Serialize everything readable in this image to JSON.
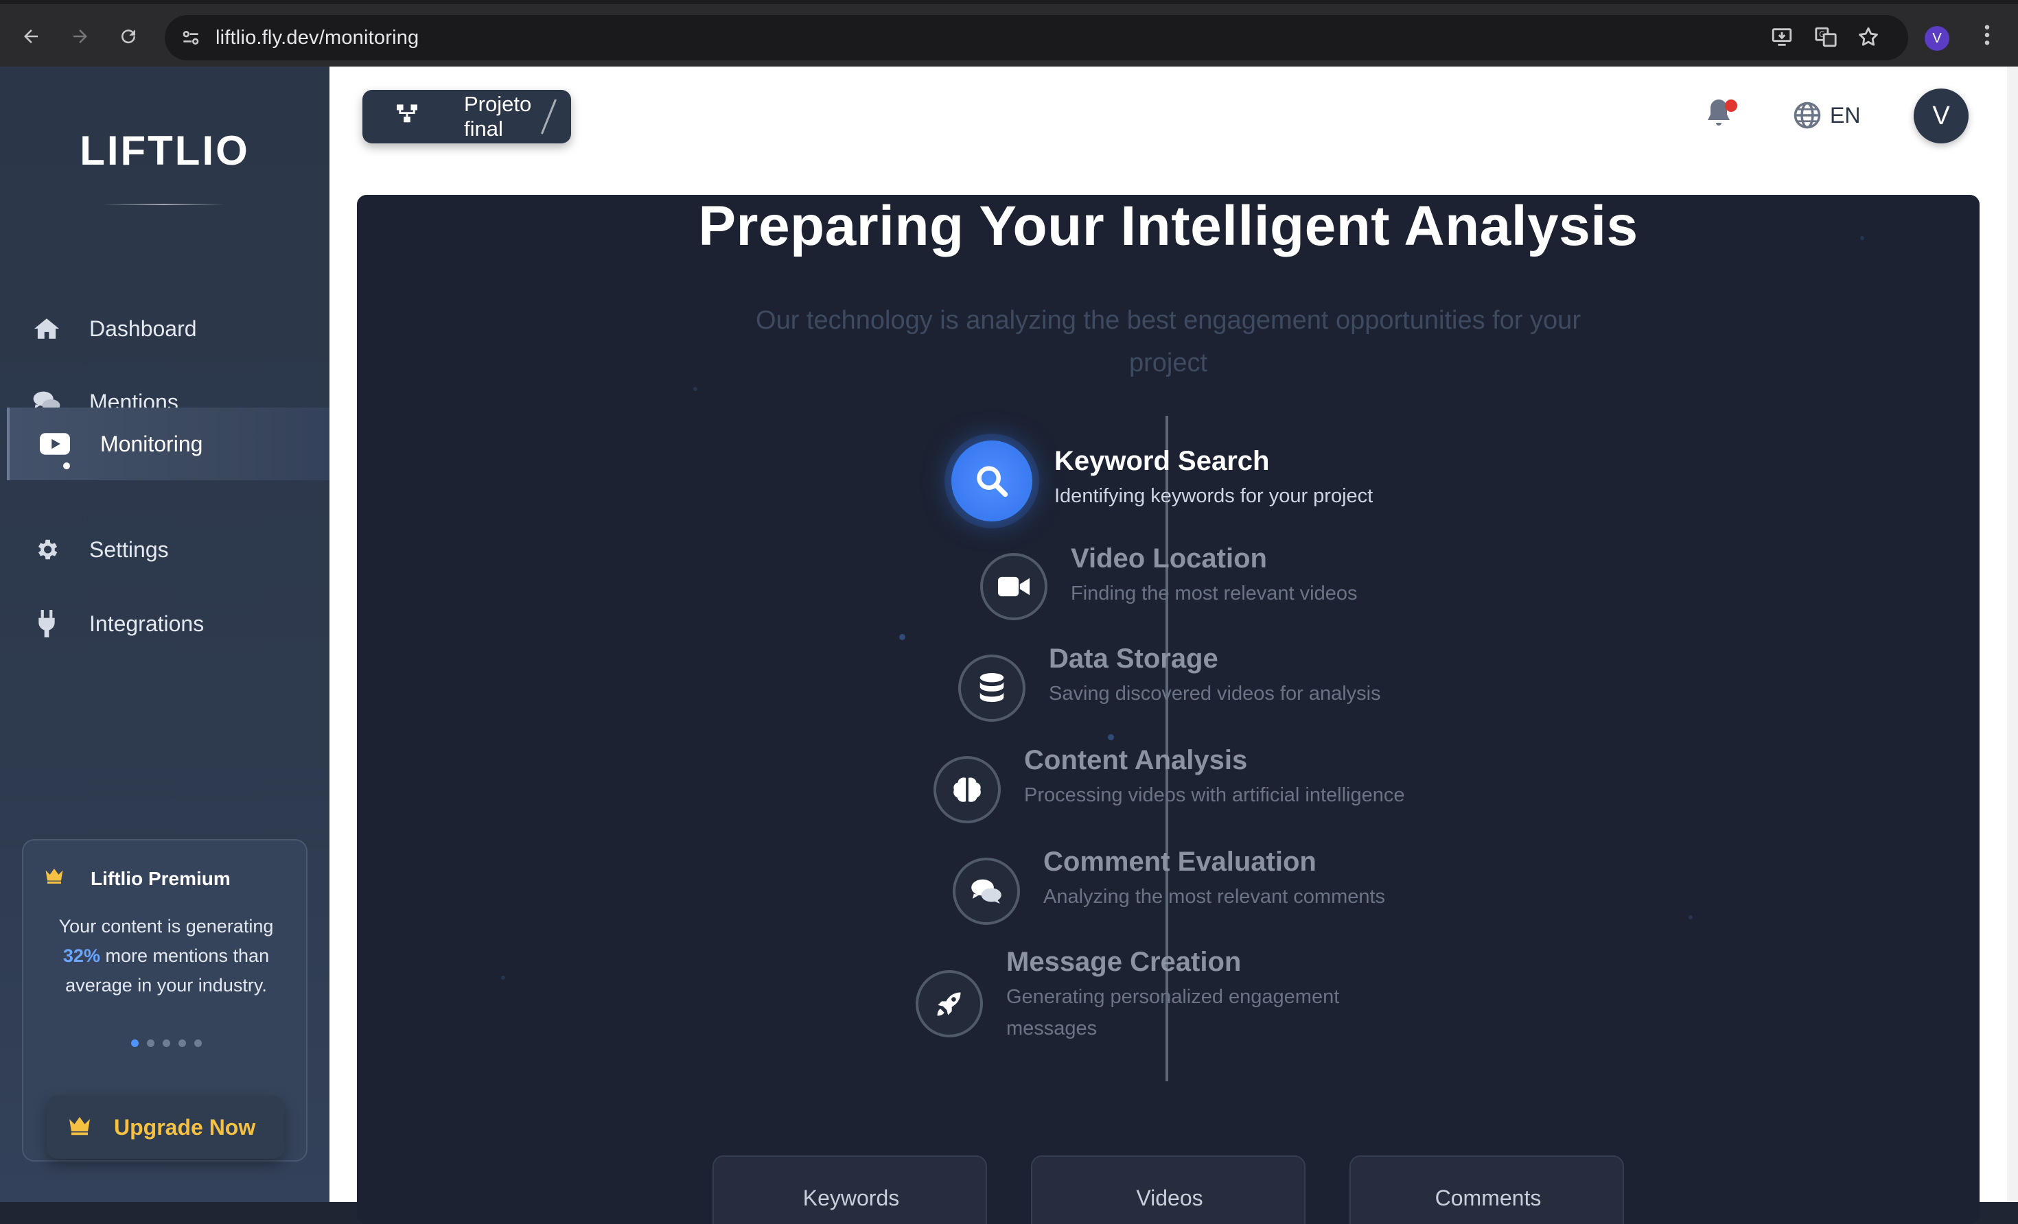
{
  "browser": {
    "url": "liftlio.fly.dev/monitoring",
    "profile_initial": "V"
  },
  "sidebar": {
    "logo": "LIFTLIO",
    "items": [
      {
        "label": "Dashboard",
        "icon": "home-icon"
      },
      {
        "label": "Mentions",
        "icon": "chat-bubbles-icon"
      },
      {
        "label": "Monitoring",
        "icon": "youtube-play-icon",
        "active": true
      },
      {
        "label": "Settings",
        "icon": "gear-icon"
      },
      {
        "label": "Integrations",
        "icon": "plug-icon"
      }
    ],
    "premium": {
      "title": "Liftlio Premium",
      "text_before": "Your content is generating",
      "percent": "32%",
      "text_after": "more mentions than average in your industry.",
      "carousel_total": 5,
      "carousel_active": 1,
      "upgrade_label": "Upgrade Now"
    }
  },
  "header": {
    "project_label": "Projeto final",
    "language": "EN",
    "avatar_initial": "V"
  },
  "colors": {
    "accent": "#3a7cf2",
    "premium_gold": "#f5c143",
    "panel_bg": "#1c2232",
    "sidebar_bg": "#2b3648",
    "notification": "#e0362f"
  },
  "analysis": {
    "title": "Preparing Your Intelligent Analysis",
    "subtitle": "Our technology is analyzing the best engagement opportunities for your project",
    "steps": [
      {
        "name": "Keyword Search",
        "desc": "Identifying keywords for your project",
        "icon": "search-icon",
        "status": "active"
      },
      {
        "name": "Video Location",
        "desc": "Finding the most relevant videos",
        "icon": "video-camera-icon",
        "status": "pending"
      },
      {
        "name": "Data Storage",
        "desc": "Saving discovered videos for analysis",
        "icon": "database-icon",
        "status": "pending"
      },
      {
        "name": "Content Analysis",
        "desc": "Processing videos with artificial intelligence",
        "icon": "brain-icon",
        "status": "pending"
      },
      {
        "name": "Comment Evaluation",
        "desc": "Analyzing the most relevant comments",
        "icon": "comments-icon",
        "status": "pending"
      },
      {
        "name": "Message Creation",
        "desc_line1": "Generating personalized engagement",
        "desc_line2": "messages",
        "icon": "rocket-icon",
        "status": "pending"
      }
    ],
    "stat_cards": [
      "Keywords",
      "Videos",
      "Comments"
    ]
  }
}
